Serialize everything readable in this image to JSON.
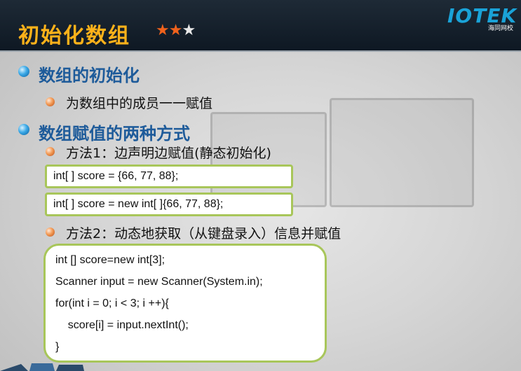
{
  "header": {
    "title": "初始化数组",
    "stars_filled": 2,
    "stars_total": 3,
    "logo_text": "IOTEK",
    "logo_subtext": "海同网校"
  },
  "sections": [
    {
      "heading": "数组的初始化",
      "items": [
        {
          "text": "为数组中的成员一一赋值"
        }
      ]
    },
    {
      "heading": "数组赋值的两种方式",
      "items": [
        {
          "text": "方法1：边声明边赋值(静态初始化)"
        },
        {
          "text": "方法2：动态地获取（从键盘录入）信息并赋值"
        }
      ]
    }
  ],
  "code": {
    "static_1": "int[ ] score = {66, 77, 88};",
    "static_2": "int[ ] score = new int[ ]{66, 77, 88};",
    "dynamic": [
      "int [] score=new int[3];",
      "Scanner input = new Scanner(System.in);",
      "for(int i = 0; i < 3; i ++){",
      "    score[i] = input.nextInt();",
      "}"
    ]
  },
  "colors": {
    "title": "#ffb21a",
    "heading": "#1e5b9a",
    "code_border": "#a8c65a",
    "star_on": "#f0621c"
  }
}
